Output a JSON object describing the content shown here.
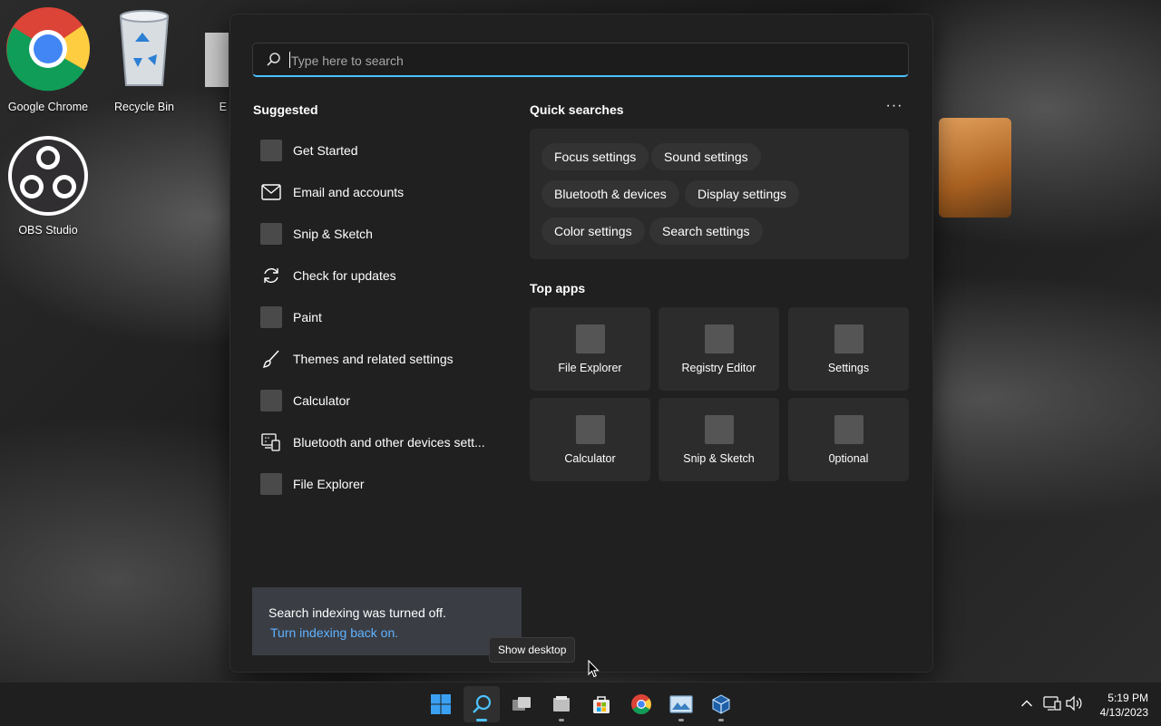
{
  "desktop": {
    "icons": [
      {
        "label": "Google Chrome"
      },
      {
        "label": "Recycle Bin"
      },
      {
        "label": "E"
      },
      {
        "label": "OBS Studio"
      }
    ]
  },
  "search": {
    "placeholder": "Type here to search",
    "value": ""
  },
  "suggested": {
    "title": "Suggested",
    "items": [
      {
        "label": "Get Started",
        "icon": "app-placeholder-icon"
      },
      {
        "label": "Email and accounts",
        "icon": "mail-icon"
      },
      {
        "label": "Snip & Sketch",
        "icon": "app-placeholder-icon"
      },
      {
        "label": "Check for updates",
        "icon": "refresh-icon"
      },
      {
        "label": "Paint",
        "icon": "app-placeholder-icon"
      },
      {
        "label": "Themes and related settings",
        "icon": "brush-icon"
      },
      {
        "label": "Calculator",
        "icon": "app-placeholder-icon"
      },
      {
        "label": "Bluetooth and other devices sett...",
        "icon": "devices-icon"
      },
      {
        "label": "File Explorer",
        "icon": "app-placeholder-icon"
      }
    ]
  },
  "quick_searches": {
    "title": "Quick searches",
    "more_label": "···",
    "chips": [
      {
        "label": "Focus settings"
      },
      {
        "label": "Sound settings"
      },
      {
        "label": "Bluetooth & devices"
      },
      {
        "label": "Display settings"
      },
      {
        "label": "Color settings"
      },
      {
        "label": "Search settings"
      }
    ]
  },
  "top_apps": {
    "title": "Top apps",
    "apps": [
      {
        "label": "File Explorer"
      },
      {
        "label": "Registry Editor"
      },
      {
        "label": "Settings"
      },
      {
        "label": "Calculator"
      },
      {
        "label": "Snip & Sketch"
      },
      {
        "label": "0ptional"
      }
    ]
  },
  "indexing": {
    "message": "Search indexing was turned off.",
    "link": "Turn indexing back on."
  },
  "tooltip": {
    "label": "Show desktop"
  },
  "taskbar": {
    "time": "5:19 PM",
    "date": "4/13/2023",
    "accent": "#4cc2ff"
  }
}
